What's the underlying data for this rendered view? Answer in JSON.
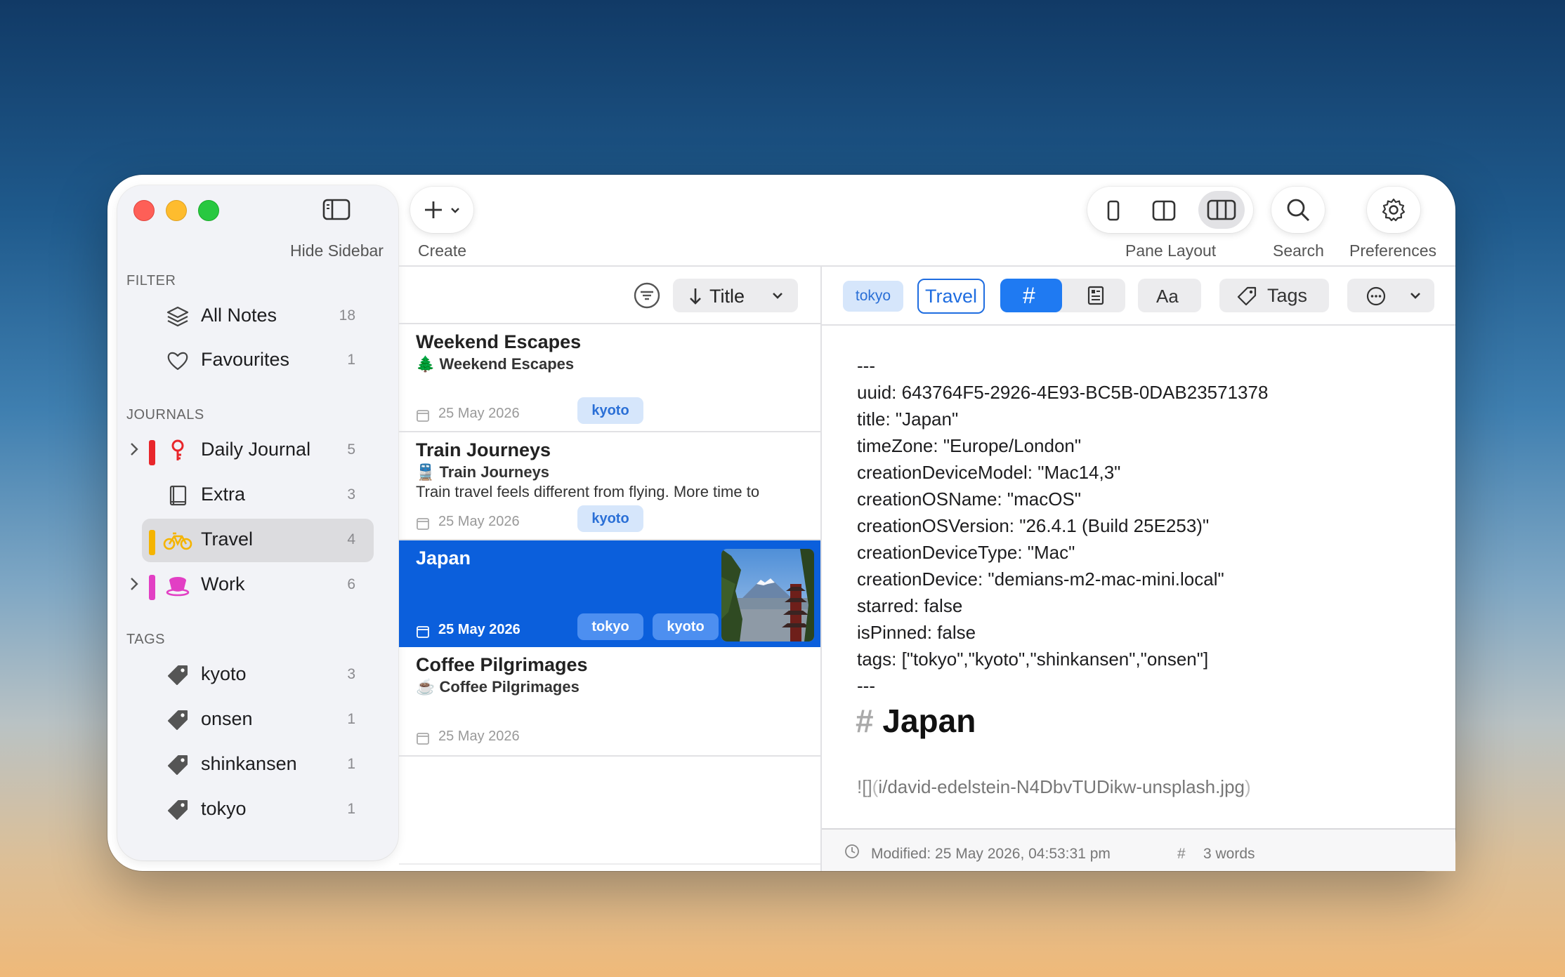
{
  "window": {
    "hide_sidebar_label": "Hide Sidebar",
    "create_label": "Create",
    "pane_layout_label": "Pane Layout",
    "search_label": "Search",
    "preferences_label": "Preferences"
  },
  "sidebar": {
    "filter_header": "FILTER",
    "filters": [
      {
        "label": "All Notes",
        "count": "18",
        "icon": "stack-icon"
      },
      {
        "label": "Favourites",
        "count": "1",
        "icon": "heart-icon"
      }
    ],
    "journals_header": "JOURNALS",
    "journals": [
      {
        "label": "Daily Journal",
        "count": "5",
        "color": "#e8262b",
        "icon": "key-icon",
        "expandable": true
      },
      {
        "label": "Extra",
        "count": "3",
        "icon": "book-icon"
      },
      {
        "label": "Travel",
        "count": "4",
        "color": "#f5b400",
        "icon": "bicycle-icon",
        "selected": true
      },
      {
        "label": "Work",
        "count": "6",
        "color": "#e23fc4",
        "icon": "cup-icon",
        "expandable": true
      }
    ],
    "tags_header": "TAGS",
    "tags": [
      {
        "label": "kyoto",
        "count": "3"
      },
      {
        "label": "onsen",
        "count": "1"
      },
      {
        "label": "shinkansen",
        "count": "1"
      },
      {
        "label": "tokyo",
        "count": "1"
      }
    ]
  },
  "list": {
    "sort_label": "Title",
    "items": [
      {
        "title": "Weekend Escapes",
        "sub_emoji": "🌲",
        "subtitle": "Weekend Escapes",
        "excerpt": "",
        "date": "25 May 2026",
        "tags": [
          "kyoto"
        ]
      },
      {
        "title": "Train Journeys",
        "sub_emoji": "🚆",
        "subtitle": "Train Journeys",
        "excerpt": "Train travel feels different from flying. More time to",
        "date": "25 May 2026",
        "tags": [
          "kyoto"
        ]
      },
      {
        "title": "Japan",
        "date": "25 May 2026",
        "tags": [
          "tokyo",
          "kyoto"
        ],
        "selected": true
      },
      {
        "title": "Coffee Pilgrimages",
        "sub_emoji": "☕",
        "subtitle": "Coffee Pilgrimages",
        "excerpt": "",
        "date": "25 May 2026",
        "tags": []
      }
    ]
  },
  "editor": {
    "tag_chip": "tokyo",
    "journal_chip": "Travel",
    "hash_symbol": "#",
    "font_button": "Aa",
    "tags_button": "Tags",
    "frontmatter": [
      "---",
      "uuid: 643764F5-2926-4E93-BC5B-0DAB23571378",
      "title: \"Japan\"",
      "timeZone: \"Europe/London\"",
      "creationDeviceModel: \"Mac14,3\"",
      "creationOSName: \"macOS\"",
      "creationOSVersion: \"26.4.1 (Build 25E253)\"",
      "creationDeviceType: \"Mac\"",
      "creationDevice: \"demians-m2-mac-mini.local\"",
      "starred: false",
      "isPinned: false",
      "tags: [\"tokyo\",\"kyoto\",\"shinkansen\",\"onsen\"]",
      "---"
    ],
    "heading_mark": "#",
    "heading": "Japan",
    "image_prefix": "![]",
    "image_paren_open": "(",
    "image_path": "i/david-edelstein-N4DbvTUDikw-unsplash.jpg",
    "image_paren_close": ")"
  },
  "status": {
    "modified": "Modified: 25 May 2026, 04:53:31 pm",
    "word_count": "3 words"
  }
}
